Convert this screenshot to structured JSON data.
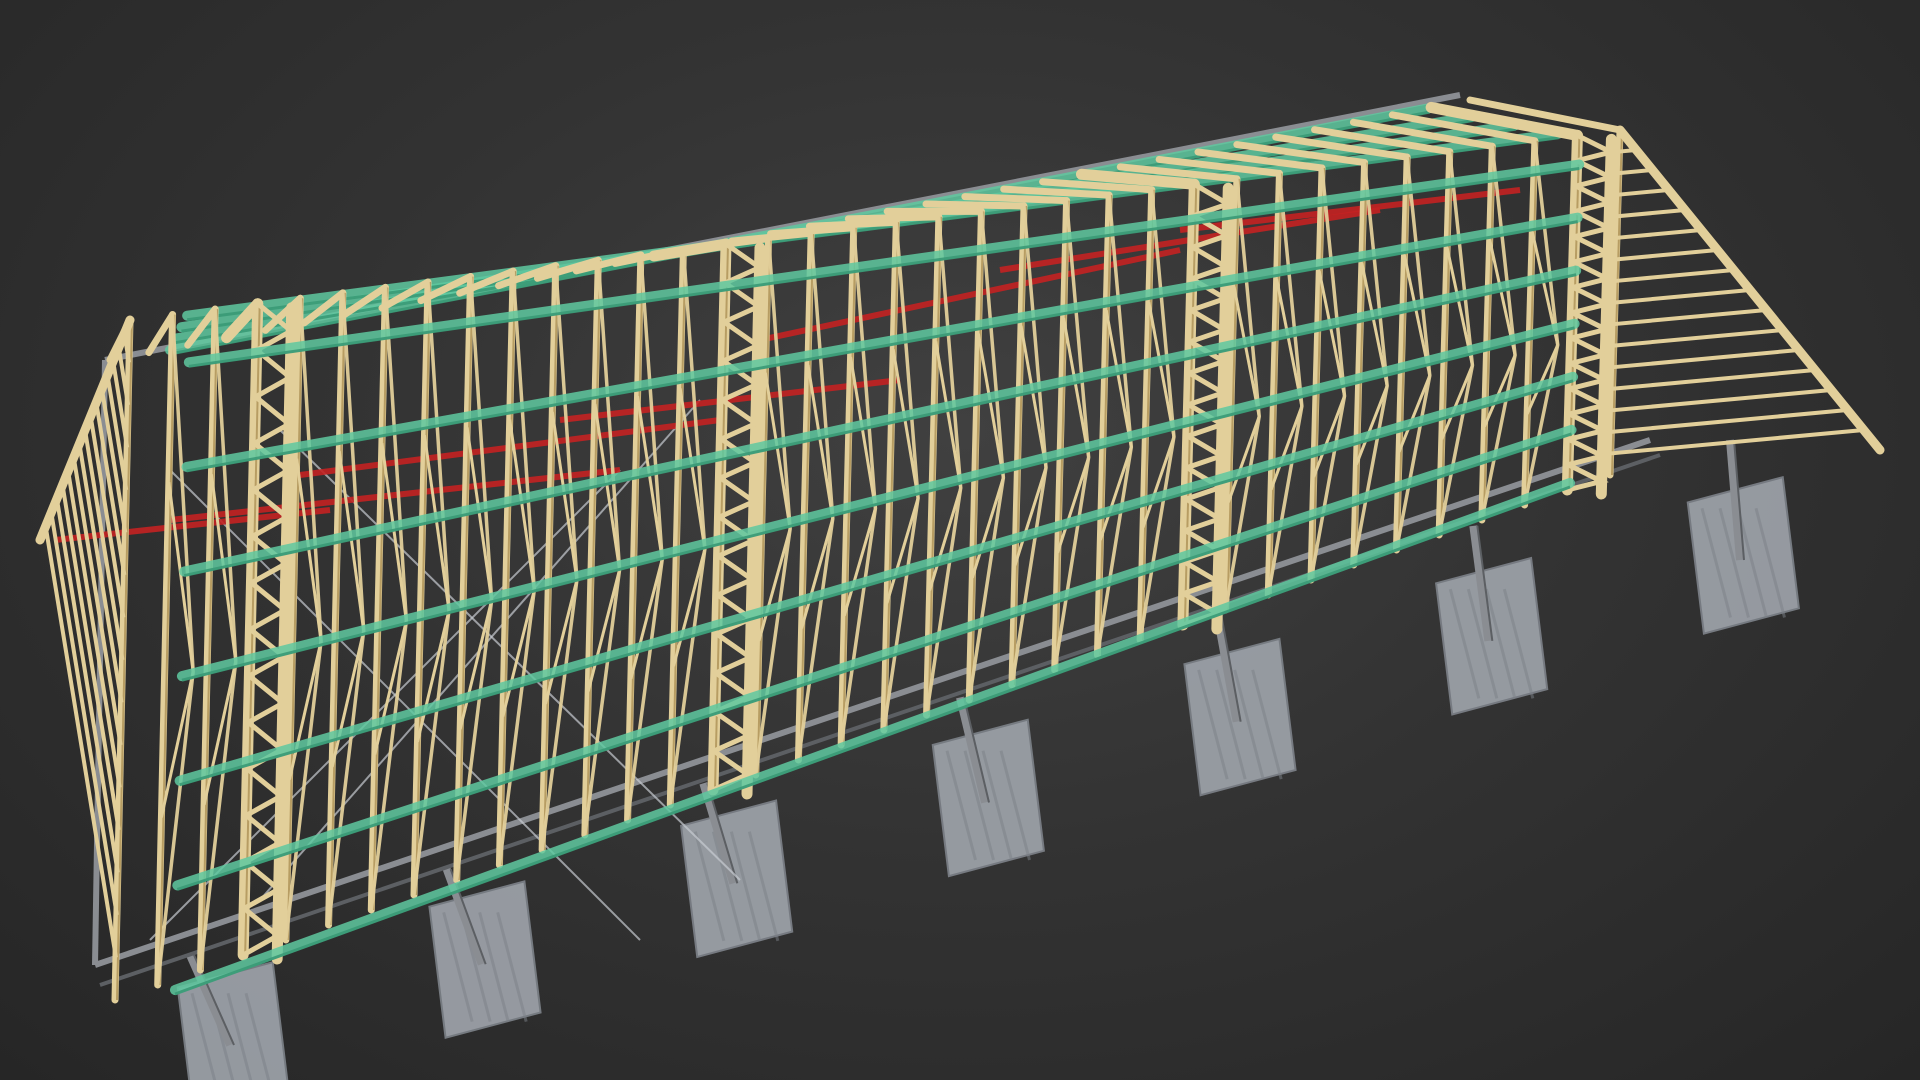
{
  "scene": {
    "subject": "timber-roof-truss-model",
    "colors": {
      "background": "#333333",
      "timber": "#e2cf9a",
      "timber_edge": "#b79d63",
      "purlin": "#5fc9a0",
      "purlin_edge": "#3a9a76",
      "bracing": "#c42222",
      "steel": "#8a8d92",
      "steel_edge": "#5c5f63",
      "footing": "#9ea3aa",
      "footing_edge": "#7c8188",
      "cable": "#c8ccd2"
    },
    "icons": {
      "truss": "truss-icon",
      "footing": "concrete-footing-icon",
      "column": "steel-column-icon"
    },
    "truss_count": 36,
    "column_count": 7
  }
}
